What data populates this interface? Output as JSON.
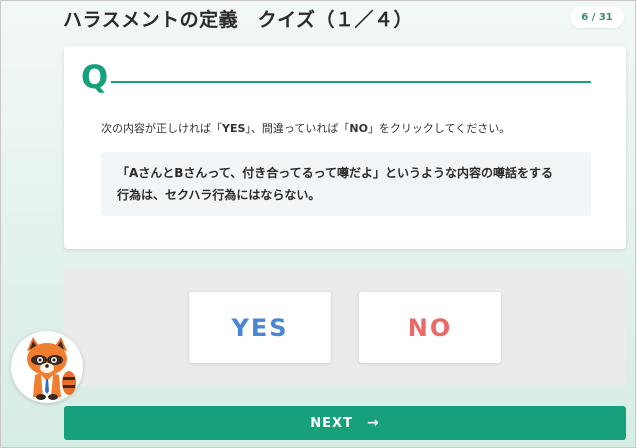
{
  "header": {
    "title": "ハラスメントの定義　クイズ（１／４）",
    "page_counter": "6 / 31"
  },
  "question": {
    "mark": "Q",
    "instruction_before": "次の内容が正しければ「",
    "instruction_yes": "YES",
    "instruction_middle": "」、間違っていれば「",
    "instruction_no": "NO",
    "instruction_after": "」をクリックしてください。",
    "statement_line1": "「AさんとBさんって、付き合ってるって噂だよ」というような内容の噂話をする",
    "statement_line2": "行為は、セクハラ行為にはならない。"
  },
  "answers": {
    "yes_label": "YES",
    "no_label": "NO"
  },
  "footer": {
    "next_label": "NEXT",
    "next_arrow": "→"
  },
  "colors": {
    "accent": "#16a07c",
    "yes": "#4a86d6",
    "no": "#ea6a6a"
  },
  "icons": {
    "mascot": "raccoon-mascot-icon",
    "next_arrow": "arrow-right-icon"
  }
}
